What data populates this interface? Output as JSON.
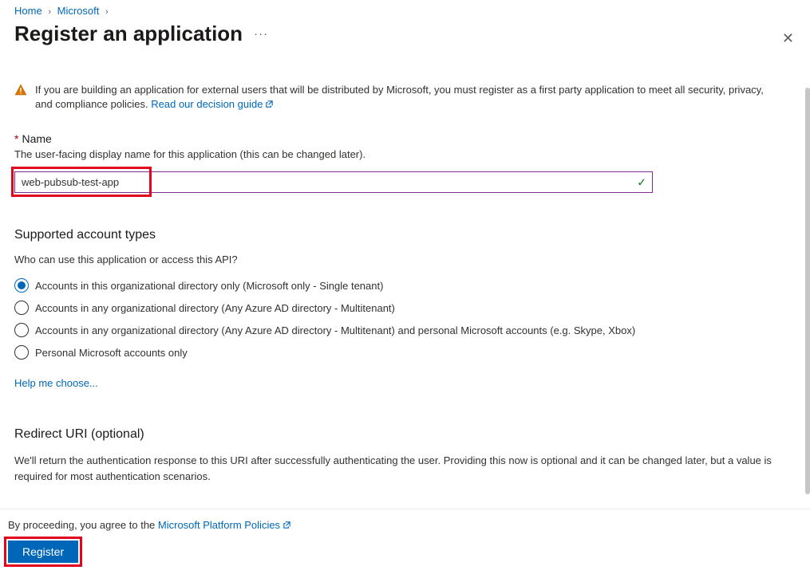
{
  "breadcrumb": {
    "home": "Home",
    "second": "Microsoft"
  },
  "title": "Register an application",
  "warning": {
    "text": "If you are building an application for external users that will be distributed by Microsoft, you must register as a first party application to meet all security, privacy, and compliance policies. ",
    "link": "Read our decision guide"
  },
  "name_field": {
    "label": "Name",
    "hint": "The user-facing display name for this application (this can be changed later).",
    "value": "web-pubsub-test-app"
  },
  "account_types": {
    "heading": "Supported account types",
    "hint": "Who can use this application or access this API?",
    "options": [
      "Accounts in this organizational directory only (Microsoft only - Single tenant)",
      "Accounts in any organizational directory (Any Azure AD directory - Multitenant)",
      "Accounts in any organizational directory (Any Azure AD directory - Multitenant) and personal Microsoft accounts (e.g. Skype, Xbox)",
      "Personal Microsoft accounts only"
    ],
    "selected_index": 0,
    "help_link": "Help me choose..."
  },
  "redirect": {
    "heading": "Redirect URI (optional)",
    "desc": "We'll return the authentication response to this URI after successfully authenticating the user. Providing this now is optional and it can be changed later, but a value is required for most authentication scenarios."
  },
  "footer": {
    "policy_prefix": "By proceeding, you agree to the ",
    "policy_link": "Microsoft Platform Policies",
    "register": "Register"
  }
}
